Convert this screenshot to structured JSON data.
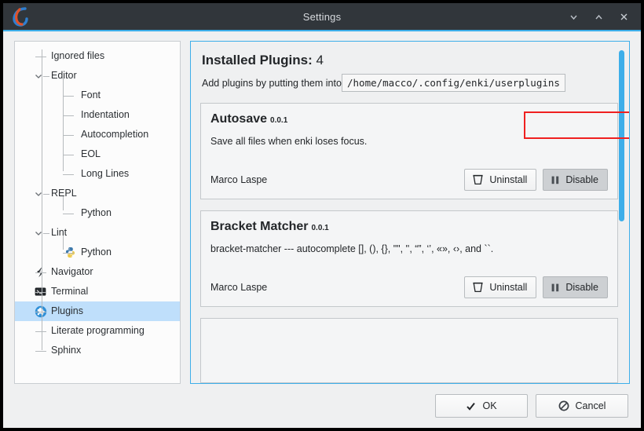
{
  "window": {
    "title": "Settings",
    "logo_icon": "enki-logo-icon",
    "controls": [
      {
        "name": "minimize-button",
        "icon": "chevron-down-icon"
      },
      {
        "name": "maximize-button",
        "icon": "chevron-up-icon"
      },
      {
        "name": "close-button",
        "icon": "close-icon"
      }
    ]
  },
  "sidebar": {
    "items": [
      {
        "label": "Ignored files",
        "level": 1,
        "expander": "none",
        "icon": "none",
        "selected": false
      },
      {
        "label": "Editor",
        "level": 1,
        "expander": "expanded",
        "icon": "none",
        "selected": false
      },
      {
        "label": "Font",
        "level": 2,
        "expander": "none",
        "icon": "none",
        "selected": false
      },
      {
        "label": "Indentation",
        "level": 2,
        "expander": "none",
        "icon": "none",
        "selected": false
      },
      {
        "label": "Autocompletion",
        "level": 2,
        "expander": "none",
        "icon": "none",
        "selected": false
      },
      {
        "label": "EOL",
        "level": 2,
        "expander": "none",
        "icon": "none",
        "selected": false
      },
      {
        "label": "Long Lines",
        "level": 2,
        "expander": "none",
        "icon": "none",
        "selected": false
      },
      {
        "label": "REPL",
        "level": 1,
        "expander": "expanded",
        "icon": "none",
        "selected": false
      },
      {
        "label": "Python",
        "level": 2,
        "expander": "none",
        "icon": "none",
        "selected": false
      },
      {
        "label": "Lint",
        "level": 1,
        "expander": "expanded",
        "icon": "none",
        "selected": false
      },
      {
        "label": "Python",
        "level": 2,
        "expander": "none",
        "icon": "python-icon",
        "selected": false
      },
      {
        "label": "Navigator",
        "level": 1,
        "expander": "none",
        "icon": "navigator-icon",
        "selected": false
      },
      {
        "label": "Terminal",
        "level": 1,
        "expander": "none",
        "icon": "terminal-icon",
        "selected": false
      },
      {
        "label": "Plugins",
        "level": 1,
        "expander": "none",
        "icon": "plugins-icon",
        "selected": true
      },
      {
        "label": "Literate programming",
        "level": 1,
        "expander": "none",
        "icon": "none",
        "selected": false
      },
      {
        "label": "Sphinx",
        "level": 1,
        "expander": "none",
        "icon": "none",
        "selected": false
      }
    ]
  },
  "main": {
    "heading_label": "Installed Plugins:",
    "heading_count": "4",
    "subtitle": "Add plugins by putting them into",
    "path_value": "/home/macco/.config/enki/userplugins",
    "annotation": {
      "name": "red-highlight-box",
      "color": "#ef2020"
    },
    "scrollbar": {
      "name": "vertical-scrollbar",
      "color": "#3daee9"
    },
    "plugins": [
      {
        "name": "Autosave",
        "version": "0.0.1",
        "description": "Save all files when enki loses focus.",
        "author": "Marco Laspe",
        "uninstall_label": "Uninstall",
        "toggle_label": "Disable",
        "toggle_pressed": true
      },
      {
        "name": "Bracket Matcher",
        "version": "0.0.1",
        "description": "bracket-matcher --- autocomplete [], (), {}, \"\", '', “”, ‘’, «», ‹›, and ``.",
        "author": "Marco Laspe",
        "uninstall_label": "Uninstall",
        "toggle_label": "Disable",
        "toggle_pressed": true
      }
    ]
  },
  "footer": {
    "ok_label": "OK",
    "ok_icon": "check-icon",
    "cancel_label": "Cancel",
    "cancel_icon": "no-entry-icon"
  }
}
